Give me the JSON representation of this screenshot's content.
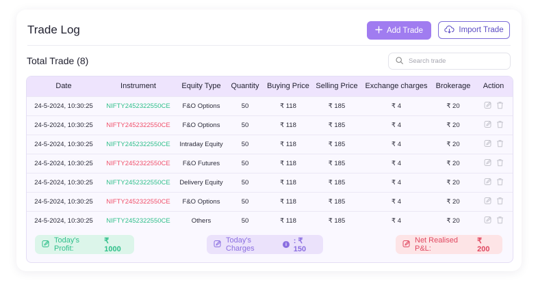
{
  "page": {
    "title": "Trade Log",
    "add_trade_label": "Add Trade",
    "import_trade_label": "Import Trade",
    "total_label": "Total Trade (8)",
    "search_placeholder": "Search trade"
  },
  "table": {
    "headers": [
      "Date",
      "Instrument",
      "Equity Type",
      "Quantity",
      "Buying Price",
      "Selling Price",
      "Exchange charges",
      "Brokerage",
      "Action"
    ],
    "rows": [
      {
        "date": "24-5-2024, 10:30:25",
        "instrument": "NIFTY2452322550CE",
        "instrument_color": "green",
        "equity": "F&O Options",
        "qty": "50",
        "buy": "₹ 118",
        "sell": "₹ 185",
        "exchange": "₹ 4",
        "brokerage": "₹ 20"
      },
      {
        "date": "24-5-2024, 10:30:25",
        "instrument": "NIFTY2452322550CE",
        "instrument_color": "red",
        "equity": "F&O Options",
        "qty": "50",
        "buy": "₹ 118",
        "sell": "₹ 185",
        "exchange": "₹ 4",
        "brokerage": "₹ 20"
      },
      {
        "date": "24-5-2024, 10:30:25",
        "instrument": "NIFTY2452322550CE",
        "instrument_color": "green",
        "equity": "Intraday Equity",
        "qty": "50",
        "buy": "₹ 118",
        "sell": "₹ 185",
        "exchange": "₹ 4",
        "brokerage": "₹ 20"
      },
      {
        "date": "24-5-2024, 10:30:25",
        "instrument": "NIFTY2452322550CE",
        "instrument_color": "red",
        "equity": "F&O Futures",
        "qty": "50",
        "buy": "₹ 118",
        "sell": "₹ 185",
        "exchange": "₹ 4",
        "brokerage": "₹ 20"
      },
      {
        "date": "24-5-2024, 10:30:25",
        "instrument": "NIFTY2452322550CE",
        "instrument_color": "green",
        "equity": "Delivery Equity",
        "qty": "50",
        "buy": "₹ 118",
        "sell": "₹ 185",
        "exchange": "₹ 4",
        "brokerage": "₹ 20"
      },
      {
        "date": "24-5-2024, 10:30:25",
        "instrument": "NIFTY2452322550CE",
        "instrument_color": "red",
        "equity": "F&O Options",
        "qty": "50",
        "buy": "₹ 118",
        "sell": "₹ 185",
        "exchange": "₹ 4",
        "brokerage": "₹ 20"
      },
      {
        "date": "24-5-2024, 10:30:25",
        "instrument": "NIFTY2452322550CE",
        "instrument_color": "green",
        "equity": "Others",
        "qty": "50",
        "buy": "₹ 118",
        "sell": "₹ 185",
        "exchange": "₹ 4",
        "brokerage": "₹ 20"
      }
    ]
  },
  "summary": {
    "profit_label": "Today's Profit:",
    "profit_value": "₹ 1000",
    "charges_label": "Today's Charges",
    "charges_value": ": ₹ 150",
    "pnl_label": "Net Realised P&L:",
    "pnl_value": "₹ 200"
  },
  "colors": {
    "accent": "#a07cf0",
    "profit": "#2fbf8a",
    "loss": "#f0506a",
    "header_bg": "#eee4fd"
  }
}
